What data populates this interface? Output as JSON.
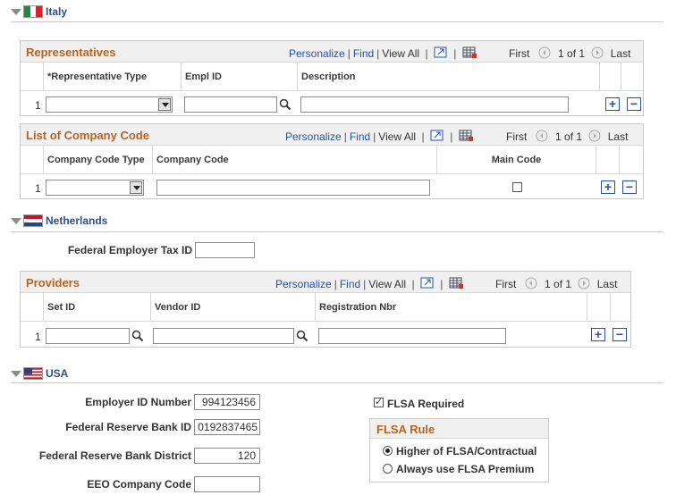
{
  "italy": {
    "section_label": "Italy",
    "flag_icon": "italy-flag-icon",
    "representatives": {
      "title": "Representatives",
      "nav": {
        "personalize": "Personalize",
        "find": "Find",
        "view_all": "View All",
        "first": "First",
        "range": "1 of 1",
        "last": "Last"
      },
      "columns": [
        "*Representative Type",
        "Empl ID",
        "Description"
      ],
      "row_number": "1",
      "row": {
        "rep_type": "",
        "empl_id": "",
        "description": ""
      }
    },
    "company_codes": {
      "title": "List of Company Code",
      "nav": {
        "personalize": "Personalize",
        "find": "Find",
        "view_all": "View All",
        "first": "First",
        "range": "1 of 1",
        "last": "Last"
      },
      "columns": [
        "Company Code Type",
        "Company Code",
        "Main Code"
      ],
      "row_number": "1",
      "row": {
        "type": "",
        "code": "",
        "main_code": false
      }
    }
  },
  "netherlands": {
    "section_label": "Netherlands",
    "flag_icon": "netherlands-flag-icon",
    "tax_id_label": "Federal Employer Tax ID",
    "tax_id_value": "",
    "providers": {
      "title": "Providers",
      "nav": {
        "personalize": "Personalize",
        "find": "Find",
        "view_all": "View All",
        "first": "First",
        "range": "1 of 1",
        "last": "Last"
      },
      "columns": [
        "Set ID",
        "Vendor ID",
        "Registration Nbr"
      ],
      "row_number": "1",
      "row": {
        "set_id": "",
        "vendor_id": "",
        "registration_nbr": ""
      }
    }
  },
  "usa": {
    "section_label": "USA",
    "flag_icon": "usa-flag-icon",
    "fields": {
      "employer_id_label": "Employer ID Number",
      "employer_id_value": "994123456",
      "reserve_bank_id_label": "Federal Reserve Bank ID",
      "reserve_bank_id_value": "0192837465",
      "reserve_bank_district_label": "Federal Reserve Bank District",
      "reserve_bank_district_value": "120",
      "eeo_code_label": "EEO Company Code",
      "eeo_code_value": ""
    },
    "flsa_required_label": "FLSA Required",
    "flsa_required_checked": true,
    "flsa_rule": {
      "title": "FLSA Rule",
      "options": [
        "Higher of FLSA/Contractual",
        "Always use FLSA Premium"
      ],
      "selected": "Higher of FLSA/Contractual"
    }
  },
  "colors": {
    "link": "#2a4fa8",
    "grid_title": "#b9631f",
    "section_label": "#2f4d8c"
  }
}
